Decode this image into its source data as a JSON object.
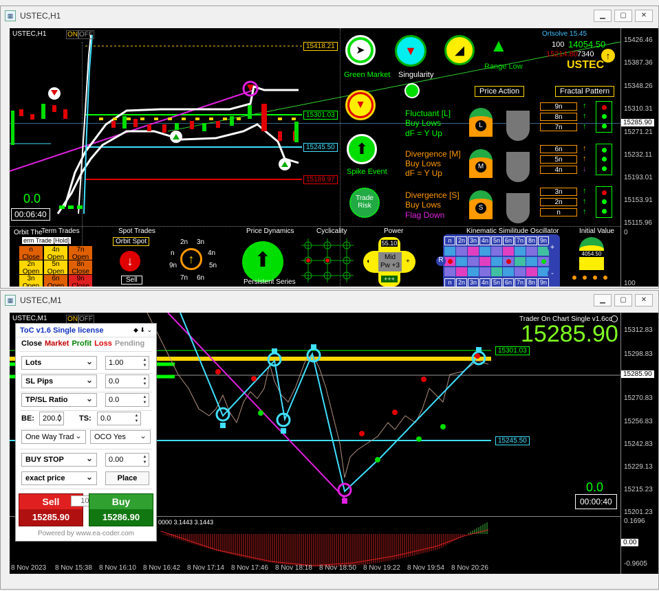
{
  "window1": {
    "title": "USTEC,H1",
    "symbol_label": "USTEC,H1",
    "onoff": [
      "ON",
      "OFF"
    ],
    "timer": "00:06:40",
    "small_value": "0.0",
    "price_levels": {
      "top": "15418.21",
      "mid": "15301.03",
      "low": "15245.50",
      "bottom": "15189.97",
      "current": "15285.90"
    },
    "axis_prices": [
      "15426.46",
      "15387.36",
      "15348.26",
      "15310.31",
      "15271.21",
      "15232.11",
      "15193.01",
      "15153.91",
      "15115.96",
      "0",
      "100"
    ],
    "header_right": {
      "line1": "Ortsolve 15.45",
      "count": "100",
      "value_a": "14054.50",
      "value_b": "15214.80",
      "value_c": "7340",
      "symbol": "USTEC"
    },
    "indicators": {
      "green_market": "Green Market",
      "singularity": "Singularity",
      "range_low": "Range Low",
      "price_action": "Price Action",
      "fractal_pattern": "Fractal Pattern",
      "spike_event": "Spike Event",
      "trade_risk": "Trade Risk",
      "fluctuant": [
        "Fluctuant [L]",
        "Buy Lows",
        "dF = Y Up"
      ],
      "divergence_m": [
        "Divergence [M]",
        "Buy Lows",
        "dF = Y Up"
      ],
      "divergence_s": [
        "Divergence [S]",
        "Buy Lows",
        "Flag Down"
      ],
      "fractal_labels_l": [
        "9n",
        "8n",
        "7n"
      ],
      "fractal_labels_m": [
        "6n",
        "5n",
        "4n"
      ],
      "fractal_labels_s": [
        "3n",
        "2n",
        "n"
      ],
      "letters": [
        "L",
        "M",
        "S"
      ]
    },
    "bottom_sections": {
      "term_trades": "Term Trades",
      "orbit_the": "Orbit The",
      "term_hold": "erm Trade [Hold]",
      "spot_trades": "Spot Trades",
      "orbit_spot": "Orbit Spot",
      "sell": "Sell",
      "price_dynamics": "Price Dynamics",
      "persistent": "Persistent Series",
      "cyclicality": "Cyclicality",
      "power": "Power",
      "power_top": "55.10",
      "power_mid": "Mid",
      "power_pw": "Pw +3",
      "power_bot": "+++",
      "kinematic": "Kinematic Similitude Oscillator",
      "initial_value": "Initial Value",
      "initial_num": "4054.50",
      "grid_cells": [
        {
          "a": "n",
          "b": "Close"
        },
        {
          "a": "4n",
          "b": "Open"
        },
        {
          "a": "7n",
          "b": "Open"
        },
        {
          "a": "2n",
          "b": "Open"
        },
        {
          "a": "5n",
          "b": "Open"
        },
        {
          "a": "8n",
          "b": "Close"
        },
        {
          "a": "3n",
          "b": "Open"
        },
        {
          "a": "6n",
          "b": "Open"
        },
        {
          "a": "9n",
          "b": "Close"
        }
      ],
      "dial_labels": [
        "2n",
        "3n",
        "n",
        "4n",
        "9n",
        "5n",
        "7n",
        "6n"
      ],
      "kso_labels": [
        "n",
        "2n",
        "3n",
        "4n",
        "5n",
        "6n",
        "7n",
        "8n",
        "9n"
      ],
      "kso_side": [
        "R",
        "+",
        "-"
      ]
    }
  },
  "window2": {
    "title": "USTEC,M1",
    "symbol_label": "USTEC,M1",
    "onoff": [
      "ON",
      "OFF"
    ],
    "big_price": "15285.90",
    "trader_label": "Trader On Chart Single v1.6cc",
    "timer": "00:00:40",
    "small_value": "0.0",
    "price_levels": {
      "top": "15301.03",
      "low": "15245.50",
      "current": "15285.90"
    },
    "axis_prices": [
      "15312.83",
      "15298.83",
      "15284.83",
      "15270.83",
      "15256.83",
      "15242.83",
      "15229.13",
      "15215.23",
      "15201.23",
      "0.1696",
      "0.00",
      "-0.9605"
    ],
    "osc_label": "0000 3.1443 3.1443",
    "time_labels": [
      "8 Nov 2023",
      "8 Nov 15:38",
      "8 Nov 16:10",
      "8 Nov 16:42",
      "8 Nov 17:14",
      "8 Nov 17:46",
      "8 Nov 18:18",
      "8 Nov 18:50",
      "8 Nov 19:22",
      "8 Nov 19:54",
      "8 Nov 20:26"
    ]
  },
  "toc": {
    "title": "ToC v1.6 Single license",
    "tabs": [
      {
        "label": "Close",
        "color": "#000000"
      },
      {
        "label": "Market",
        "color": "#c00000"
      },
      {
        "label": "Profit",
        "color": "#008000"
      },
      {
        "label": "Loss",
        "color": "#e00000"
      },
      {
        "label": "Pending",
        "color": "#999999"
      }
    ],
    "lots_label": "Lots",
    "lots_value": "1.00",
    "sl_label": "SL Pips",
    "sl_value": "0.0",
    "tp_label": "TP/SL Ratio",
    "tp_value": "0.0",
    "be_label": "BE:",
    "be_value": "200.0",
    "ts_label": "TS:",
    "ts_value": "0.0",
    "mode": "One Way Trad",
    "oco": "OCO Yes",
    "order_type": "BUY STOP",
    "order_value": "0.00",
    "price_type": "exact price",
    "place": "Place",
    "sell_label": "Sell",
    "sell_price": "15285.90",
    "spread": "10.0",
    "buy_label": "Buy",
    "buy_price": "15286.90",
    "footer": "Powered by www.ea-coder.com"
  },
  "colors": {
    "green": "#00ff00",
    "yellow": "#ffd700",
    "cyan": "#40e0ff",
    "magenta": "#e020e0",
    "orange": "#ff9900",
    "red": "#e00000"
  }
}
